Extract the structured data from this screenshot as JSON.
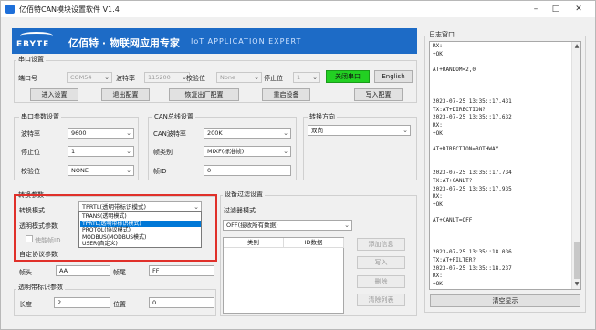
{
  "titlebar": {
    "title": "亿佰特CAN模块设置软件 V1.4"
  },
  "banner": {
    "logo": "EBYTE",
    "company": "亿佰特 · 物联网应用专家",
    "slogan": "IoT APPLICATION EXPERT"
  },
  "serial": {
    "group_title": "串口设置",
    "port_label": "端口号",
    "port_value": "COM54",
    "baud_label": "波特率",
    "baud_value": "115200",
    "parity_label": "校验位",
    "parity_value": "None",
    "stop_label": "停止位",
    "stop_value": "1",
    "close_btn": "关闭串口",
    "lang_btn": "English"
  },
  "actions": {
    "enter": "进入设置",
    "exit": "退出配置",
    "factory": "恢复出厂配置",
    "restart": "重启设备",
    "write": "写入配置"
  },
  "uart": {
    "group_title": "串口参数设置",
    "baud_label": "波特率",
    "baud_value": "9600",
    "stop_label": "停止位",
    "stop_value": "1",
    "parity_label": "校验位",
    "parity_value": "NONE"
  },
  "can": {
    "group_title": "CAN总线设置",
    "rate_label": "CAN波特率",
    "rate_value": "200K",
    "frame_label": "帧类别",
    "frame_value": "MIXF(标准帧)",
    "id_label": "帧ID",
    "id_value": "0"
  },
  "direction": {
    "group_title": "转换方向",
    "value": "双向"
  },
  "convert": {
    "group_title": "转换参数",
    "mode_label": "转换模式",
    "mode_value": "TPRTL(透明带标识模式)",
    "transparent_label": "透明模式参数",
    "sendid_label": "使能帧ID",
    "custom_label": "自定协议参数",
    "options": [
      "TPRTL(透明带标识模式)",
      "TRANS(透明模式)",
      "TPRTL(透明带标识模式)",
      "PROTOL(协议模式)",
      "MODBUS(MODBUS模式)",
      "USER(自定义)"
    ],
    "selected_index": 2
  },
  "frame": {
    "head_label": "帧头",
    "head_value": "AA",
    "tail_label": "帧尾",
    "tail_value": "FF",
    "transparent_id_label": "透明带标识参数",
    "length_label": "长度",
    "length_value": "2",
    "position_label": "位置",
    "position_value": "0"
  },
  "filter": {
    "group_title": "设备过滤设置",
    "mode_label": "过滤器模式",
    "mode_value": "OFF(接收所有数据)",
    "col_type": "类别",
    "col_id": "ID数据",
    "add_btn": "添加信息",
    "write_btn": "写入",
    "delete_btn": "删除",
    "clear_btn": "清除列表"
  },
  "log": {
    "group_title": "日志窗口",
    "lines": [
      "RX:",
      "+OK",
      "",
      "AT+RANDOM=2,0",
      "",
      "",
      "",
      "2023-07-25 13:35::17.431",
      "TX:AT+DIRECTION?",
      "2023-07-25 13:35::17.632",
      "RX:",
      "+OK",
      "",
      "AT+DIRECTION=BOTHWAY",
      "",
      "",
      "2023-07-25 13:35::17.734",
      "TX:AT+CANLT?",
      "2023-07-25 13:35::17.935",
      "RX:",
      "+OK",
      "",
      "AT+CANLT=OFF",
      "",
      "",
      "",
      "2023-07-25 13:35::18.036",
      "TX:AT+FILTER?",
      "2023-07-25 13:35::18.237",
      "RX:",
      "+OK"
    ],
    "clear_btn": "清空显示"
  },
  "colors": {
    "banner": "#1d6bc6",
    "highlight": "#e0302a",
    "green_btn": "#22d022",
    "selection": "#0078d7"
  }
}
